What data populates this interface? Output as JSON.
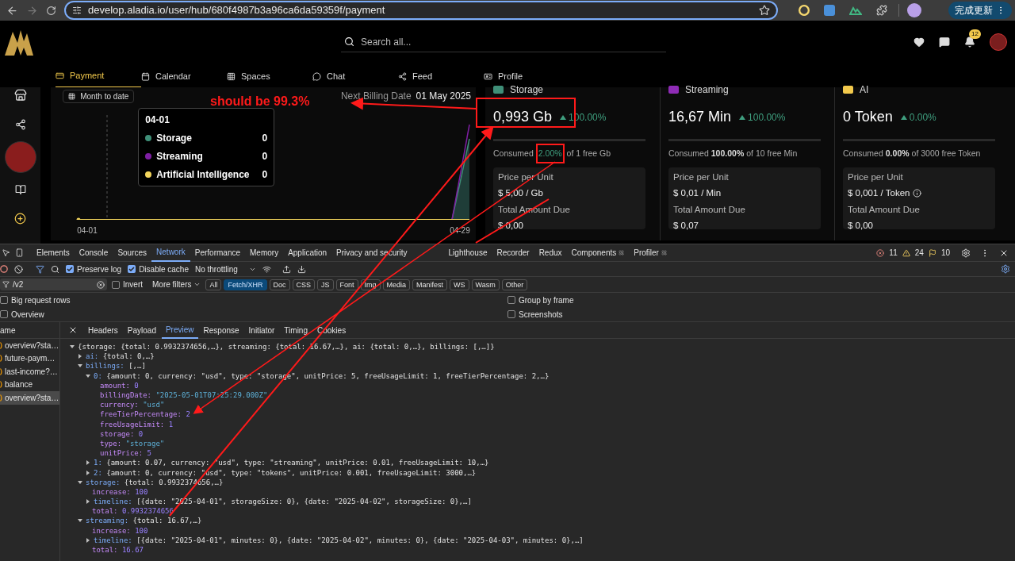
{
  "browser": {
    "url": "develop.aladia.io/user/hub/680f4987b3a96ca6da59359f/payment",
    "update_button": "完成更新"
  },
  "app": {
    "search": {
      "placeholder": "Search all..."
    },
    "notification_count": "12",
    "nav": [
      {
        "label": "Payment",
        "selected": true
      },
      {
        "label": "Calendar",
        "selected": false
      },
      {
        "label": "Spaces",
        "selected": false
      },
      {
        "label": "Chat",
        "selected": false
      },
      {
        "label": "Feed",
        "selected": false
      },
      {
        "label": "Profile",
        "selected": false
      }
    ],
    "chart_panel": {
      "range_button": "Month to date",
      "next_billing_label": "Next Billing Date",
      "next_billing_date": "01 May 2025",
      "tooltip": {
        "date": "04-01",
        "items": [
          {
            "label": "Storage",
            "value": "0",
            "color": "#3f8f78"
          },
          {
            "label": "Streaming",
            "value": "0",
            "color": "#7e1fa3"
          },
          {
            "label": "Artificial Intelligence",
            "value": "0",
            "color": "#f2d45c"
          }
        ]
      },
      "x_labels": [
        "04-01",
        "04-29"
      ]
    },
    "cards": [
      {
        "title": "Storage",
        "color": "#3f8f78",
        "amount": "0,993 Gb",
        "change": "100.00%",
        "consumed_label": "Consumed",
        "consumed_pct": "2.00%",
        "consumed_rest": "of 1 free Gb",
        "highlight": true,
        "price_label": "Price per Unit",
        "price": "$ 5,00 / Gb",
        "info": false,
        "total_label": "Total Amount Due",
        "total": "$ 0,00"
      },
      {
        "title": "Streaming",
        "color": "#8e2bb5",
        "amount": "16,67 Min",
        "change": "100.00%",
        "consumed_label": "Consumed",
        "consumed_pct": "100.00%",
        "consumed_rest": "of 10 free Min",
        "highlight": false,
        "price_label": "Price per Unit",
        "price": "$ 0,01 / Min",
        "info": false,
        "total_label": "Total Amount Due",
        "total": "$ 0,07"
      },
      {
        "title": "AI",
        "color": "#f2c94c",
        "amount": "0 Token",
        "change": "0.00%",
        "consumed_label": "Consumed",
        "consumed_pct": "0.00%",
        "consumed_rest": "of 3000 free Token",
        "highlight": false,
        "price_label": "Price per Unit",
        "price": "$ 0,001 / Token",
        "info": true,
        "total_label": "Total Amount Due",
        "total": "$ 0,00"
      }
    ],
    "annotation": "should be 99.3%"
  },
  "devtools": {
    "tabs": [
      {
        "label": "Elements",
        "selected": false
      },
      {
        "label": "Console",
        "selected": false
      },
      {
        "label": "Sources",
        "selected": false
      },
      {
        "label": "Network",
        "selected": true
      },
      {
        "label": "Performance",
        "selected": false
      },
      {
        "label": "Memory",
        "selected": false
      },
      {
        "label": "Application",
        "selected": false
      },
      {
        "label": "Privacy and security",
        "selected": false
      },
      {
        "label": "Lighthouse",
        "selected": false
      },
      {
        "label": "Recorder",
        "selected": false
      },
      {
        "label": "Redux",
        "selected": false
      },
      {
        "label": "Components",
        "selected": false
      },
      {
        "label": "Profiler",
        "selected": false
      }
    ],
    "errors": "11",
    "warnings": "24",
    "infos": "10",
    "preserve_log": {
      "label": "Preserve log",
      "checked": true
    },
    "disable_cache": {
      "label": "Disable cache",
      "checked": true
    },
    "throttling": "No throttling",
    "filter": "/v2",
    "invert": {
      "label": "Invert",
      "checked": false
    },
    "more_filters": "More filters",
    "types": [
      {
        "label": "All",
        "selected": false
      },
      {
        "label": "Fetch/XHR",
        "selected": true
      },
      {
        "label": "Doc",
        "selected": false
      },
      {
        "label": "CSS",
        "selected": false
      },
      {
        "label": "JS",
        "selected": false
      },
      {
        "label": "Font",
        "selected": false
      },
      {
        "label": "Img",
        "selected": false
      },
      {
        "label": "Media",
        "selected": false
      },
      {
        "label": "Manifest",
        "selected": false
      },
      {
        "label": "WS",
        "selected": false
      },
      {
        "label": "Wasm",
        "selected": false
      },
      {
        "label": "Other",
        "selected": false
      }
    ],
    "options_left": [
      {
        "label": "Big request rows",
        "checked": false
      },
      {
        "label": "Overview",
        "checked": false
      }
    ],
    "options_right": [
      {
        "label": "Group by frame",
        "checked": false
      },
      {
        "label": "Screenshots",
        "checked": false
      }
    ],
    "name_header": "ame",
    "requests": [
      {
        "name": "overview?sta…",
        "selected": false
      },
      {
        "name": "future-paym…",
        "selected": false
      },
      {
        "name": "last-income?…",
        "selected": false
      },
      {
        "name": "balance",
        "selected": false
      },
      {
        "name": "overview?sta…",
        "selected": true
      }
    ],
    "detail_tabs": [
      {
        "label": "Headers",
        "selected": false
      },
      {
        "label": "Payload",
        "selected": false
      },
      {
        "label": "Preview",
        "selected": true
      },
      {
        "label": "Response",
        "selected": false
      },
      {
        "label": "Initiator",
        "selected": false
      },
      {
        "label": "Timing",
        "selected": false
      },
      {
        "label": "Cookies",
        "selected": false
      }
    ],
    "preview": [
      {
        "value": "{storage: {total: 0.9932374656,…}, streaming: {total: 16.67,…}, ai: {total: 0,…}, billings: [,…]}",
        "expanded": true,
        "children": [
          {
            "key": "ai:",
            "value": "{total: 0,…}",
            "expanded": false
          },
          {
            "key": "billings:",
            "value": "[,…]",
            "expanded": true,
            "children": [
              {
                "key": "0:",
                "value": "{amount: 0, currency: \"usd\", type: \"storage\", unitPrice: 5, freeUsageLimit: 1, freeTierPercentage: 2,…}",
                "expanded": true,
                "children": [
                  {
                    "key": "amount:",
                    "value": "0",
                    "kind": "number"
                  },
                  {
                    "key": "billingDate:",
                    "value": "\"2025-05-01T07:25:29.000Z\"",
                    "kind": "string"
                  },
                  {
                    "key": "currency:",
                    "value": "\"usd\"",
                    "kind": "string"
                  },
                  {
                    "key": "freeTierPercentage:",
                    "value": "2",
                    "kind": "number"
                  },
                  {
                    "key": "freeUsageLimit:",
                    "value": "1",
                    "kind": "number"
                  },
                  {
                    "key": "storage:",
                    "value": "0",
                    "kind": "number"
                  },
                  {
                    "key": "type:",
                    "value": "\"storage\"",
                    "kind": "string"
                  },
                  {
                    "key": "unitPrice:",
                    "value": "5",
                    "kind": "number"
                  }
                ]
              },
              {
                "key": "1:",
                "value": "{amount: 0.07, currency: \"usd\", type: \"streaming\", unitPrice: 0.01, freeUsageLimit: 10,…}",
                "expanded": false
              },
              {
                "key": "2:",
                "value": "{amount: 0, currency: \"usd\", type: \"tokens\", unitPrice: 0.001, freeUsageLimit: 3000,…}",
                "expanded": false
              }
            ]
          },
          {
            "key": "storage:",
            "value": "{total: 0.9932374656,…}",
            "expanded": true,
            "children": [
              {
                "key": "increase:",
                "value": "100",
                "kind": "number"
              },
              {
                "key": "timeline:",
                "value": "[{date: \"2025-04-01\", storageSize: 0}, {date: \"2025-04-02\", storageSize: 0},…]",
                "expanded": false
              },
              {
                "key": "total:",
                "value": "0.9932374656",
                "kind": "number"
              }
            ]
          },
          {
            "key": "streaming:",
            "value": "{total: 16.67,…}",
            "expanded": true,
            "children": [
              {
                "key": "increase:",
                "value": "100",
                "kind": "number"
              },
              {
                "key": "timeline:",
                "value": "[{date: \"2025-04-01\", minutes: 0}, {date: \"2025-04-02\", minutes: 0}, {date: \"2025-04-03\", minutes: 0},…]",
                "expanded": false
              },
              {
                "key": "total:",
                "value": "16.67",
                "kind": "number"
              }
            ]
          }
        ]
      }
    ]
  }
}
